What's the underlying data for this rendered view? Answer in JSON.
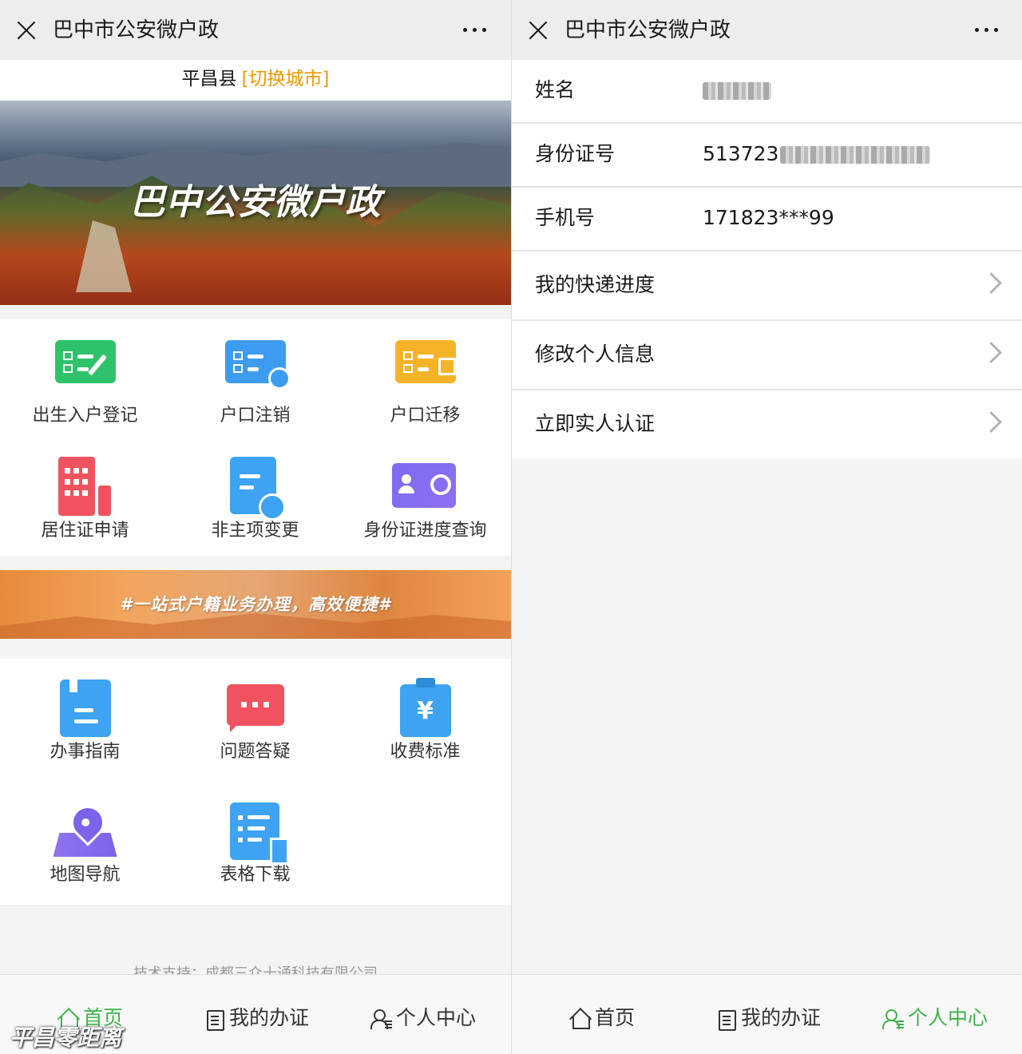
{
  "left_screen": {
    "title": "巴中市公安微户政",
    "city": {
      "name": "平昌县",
      "switch_label": "[切换城市]"
    },
    "banner_title": "巴中公安微户政",
    "services_primary": [
      {
        "label": "出生入户登记",
        "icon": "household-card-edit-icon",
        "color": "#2ec26a"
      },
      {
        "label": "户口注销",
        "icon": "household-card-cancel-icon",
        "color": "#3d9cf0"
      },
      {
        "label": "户口迁移",
        "icon": "household-card-move-icon",
        "color": "#f5b428"
      },
      {
        "label": "居住证申请",
        "icon": "building-icon",
        "color": "#f0535f"
      },
      {
        "label": "非主项变更",
        "icon": "document-refresh-icon",
        "color": "#3da3f2"
      },
      {
        "label": "身份证进度查询",
        "icon": "id-card-search-icon",
        "color": "#7b6cf0"
      }
    ],
    "slogan": "#一站式户籍业务办理，高效便捷#",
    "services_secondary": [
      {
        "label": "办事指南",
        "icon": "guide-book-icon",
        "color": "#3da3f2"
      },
      {
        "label": "问题答疑",
        "icon": "chat-bubble-icon",
        "color": "#f0535f"
      },
      {
        "label": "收费标准",
        "icon": "fee-clipboard-icon",
        "color": "#3da3f2"
      },
      {
        "label": "地图导航",
        "icon": "map-pin-icon",
        "color": "#7b63ea"
      },
      {
        "label": "表格下载",
        "icon": "form-download-icon",
        "color": "#3da3f2"
      }
    ],
    "footer_note": "技术支持：成都三众十通科技有限公司",
    "tabs": [
      {
        "label": "首页",
        "active": true
      },
      {
        "label": "我的办证",
        "active": false
      },
      {
        "label": "个人中心",
        "active": false
      }
    ],
    "watermark": "平昌零距离"
  },
  "right_screen": {
    "title": "巴中市公安微户政",
    "profile": {
      "name_label": "姓名",
      "id_label": "身份证号",
      "id_visible_prefix": "513723",
      "phone_label": "手机号",
      "phone_value": "171823***99"
    },
    "links": [
      {
        "label": "我的快递进度"
      },
      {
        "label": "修改个人信息"
      },
      {
        "label": "立即实人认证"
      }
    ],
    "tabs": [
      {
        "label": "首页",
        "active": false
      },
      {
        "label": "我的办证",
        "active": false
      },
      {
        "label": "个人中心",
        "active": true
      }
    ]
  },
  "colors": {
    "accent": "#f39800",
    "tab_active": "#3cb54a"
  }
}
